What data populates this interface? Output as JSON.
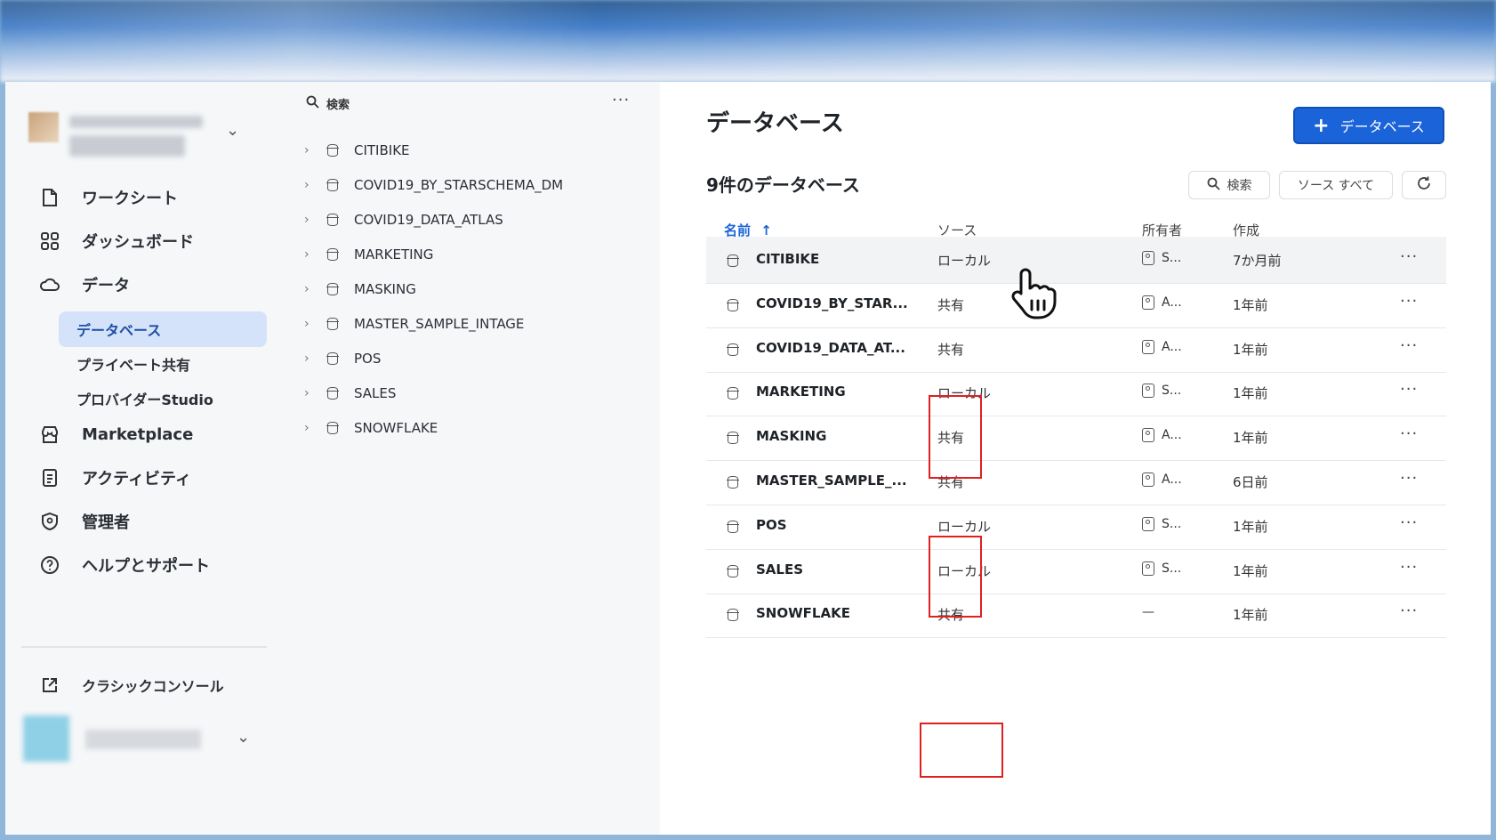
{
  "sidebar": {
    "items": [
      {
        "label": "ワークシート",
        "icon": "worksheet-icon"
      },
      {
        "label": "ダッシュボード",
        "icon": "dashboard-icon"
      },
      {
        "label": "データ",
        "icon": "cloud-icon"
      }
    ],
    "sub_items": [
      {
        "label": "データベース",
        "active": true
      },
      {
        "label": "プライベート共有",
        "active": false
      },
      {
        "label": "プロバイダーStudio",
        "active": false
      }
    ],
    "items2": [
      {
        "label": "Marketplace",
        "icon": "store-icon"
      },
      {
        "label": "アクティビティ",
        "icon": "activity-icon"
      },
      {
        "label": "管理者",
        "icon": "shield-icon"
      },
      {
        "label": "ヘルプとサポート",
        "icon": "help-icon"
      }
    ],
    "classic_console": "クラシックコンソール"
  },
  "tree": {
    "search_label": "検索",
    "items": [
      "CITIBIKE",
      "COVID19_BY_STARSCHEMA_DM",
      "COVID19_DATA_ATLAS",
      "MARKETING",
      "MASKING",
      "MASTER_SAMPLE_INTAGE",
      "POS",
      "SALES",
      "SNOWFLAKE"
    ]
  },
  "main": {
    "title": "データベース",
    "add_button": "データベース",
    "count_label": "9件のデータベース",
    "search_button": "検索",
    "source_filter": "ソース すべて",
    "columns": {
      "name": "名前",
      "source": "ソース",
      "owner": "所有者",
      "created": "作成"
    },
    "rows": [
      {
        "name": "CITIBIKE",
        "source": "ローカル",
        "owner": "S...",
        "created": "7か月前"
      },
      {
        "name": "COVID19_BY_STAR...",
        "source": "共有",
        "owner": "A...",
        "created": "1年前"
      },
      {
        "name": "COVID19_DATA_AT...",
        "source": "共有",
        "owner": "A...",
        "created": "1年前"
      },
      {
        "name": "MARKETING",
        "source": "ローカル",
        "owner": "S...",
        "created": "1年前"
      },
      {
        "name": "MASKING",
        "source": "共有",
        "owner": "A...",
        "created": "1年前"
      },
      {
        "name": "MASTER_SAMPLE_...",
        "source": "共有",
        "owner": "A...",
        "created": "6日前"
      },
      {
        "name": "POS",
        "source": "ローカル",
        "owner": "S...",
        "created": "1年前"
      },
      {
        "name": "SALES",
        "source": "ローカル",
        "owner": "S...",
        "created": "1年前"
      },
      {
        "name": "SNOWFLAKE",
        "source": "共有",
        "owner": "—",
        "created": "1年前"
      }
    ]
  },
  "colors": {
    "accent": "#1b63d8",
    "highlight": "#e02020"
  }
}
